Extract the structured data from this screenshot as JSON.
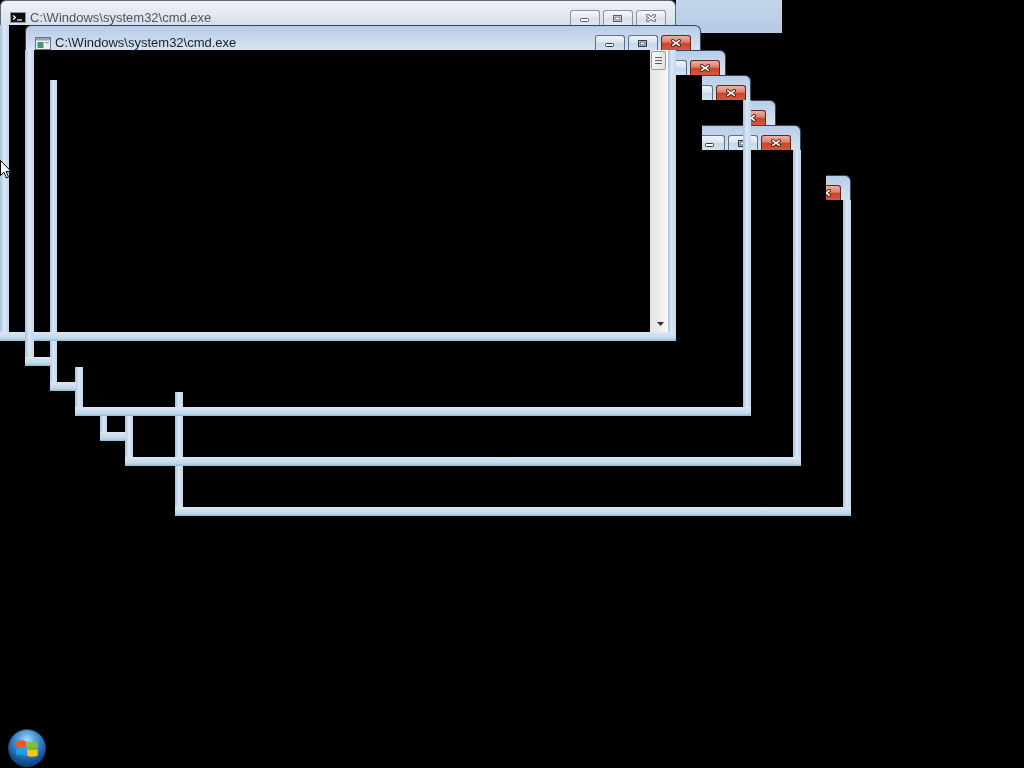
{
  "desktop": {
    "windows": [
      {
        "title": "C:\\Windows\\system32\\cmd.exe",
        "active": false
      },
      {
        "title": "C:\\Windows\\system32\\cmd.exe",
        "active": true
      },
      {
        "active": true
      },
      {
        "active": true
      },
      {
        "active": true
      },
      {
        "active": true
      },
      {
        "active": true
      }
    ]
  }
}
